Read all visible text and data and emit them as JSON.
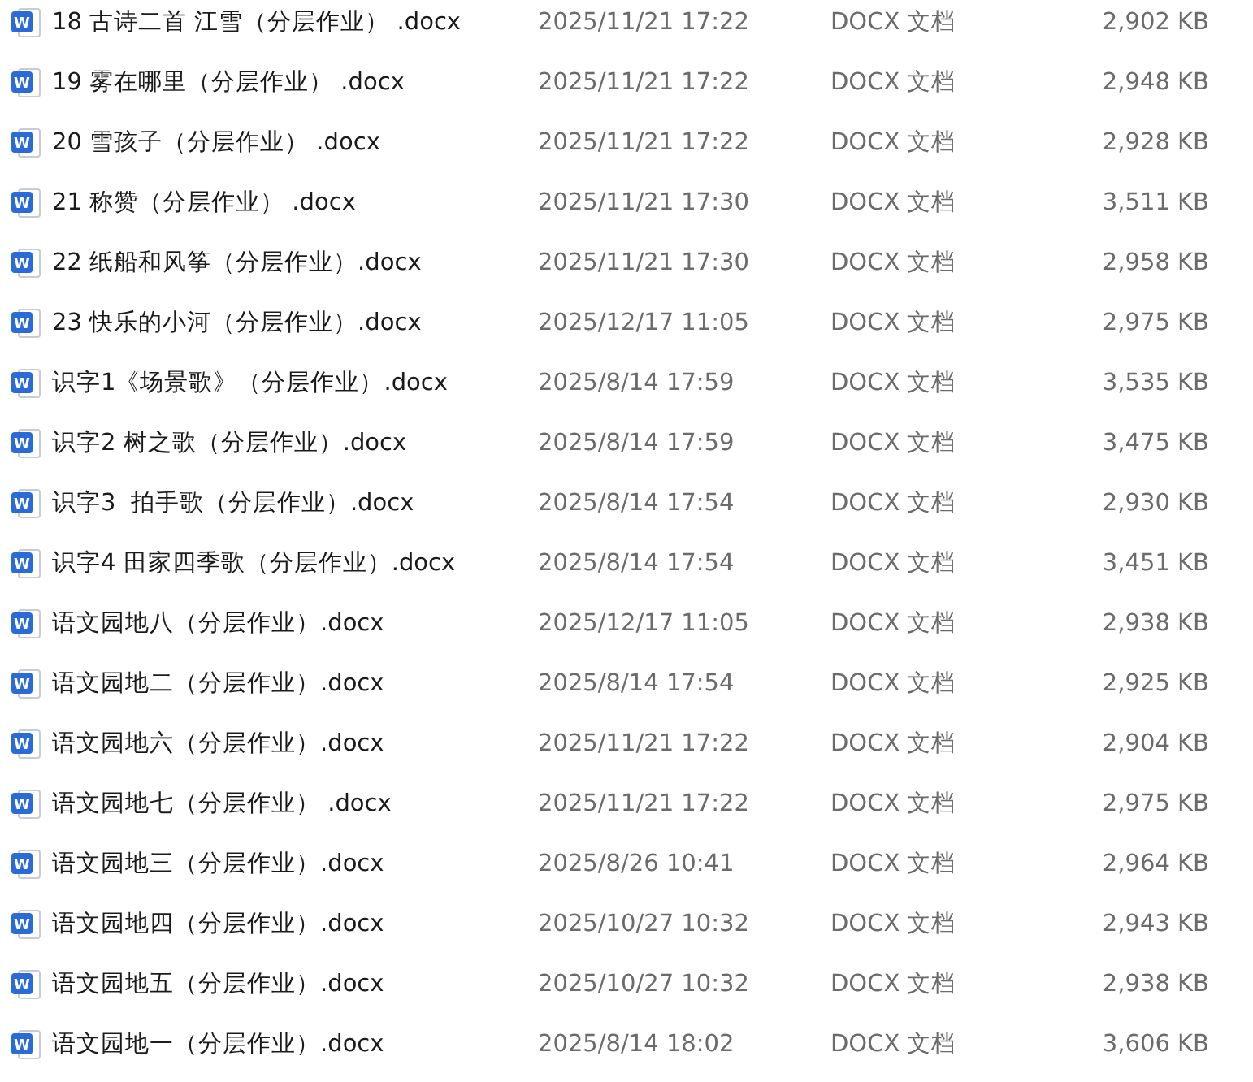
{
  "files": [
    {
      "icon_letter": "W",
      "name": "18 古诗二首 江雪（分层作业） .docx",
      "modified": "2025/11/21 17:22",
      "type": "DOCX 文档",
      "size": "2,902 KB"
    },
    {
      "icon_letter": "W",
      "name": "19 雾在哪里（分层作业） .docx",
      "modified": "2025/11/21 17:22",
      "type": "DOCX 文档",
      "size": "2,948 KB"
    },
    {
      "icon_letter": "W",
      "name": "20 雪孩子（分层作业） .docx",
      "modified": "2025/11/21 17:22",
      "type": "DOCX 文档",
      "size": "2,928 KB"
    },
    {
      "icon_letter": "W",
      "name": "21 称赞（分层作业） .docx",
      "modified": "2025/11/21 17:30",
      "type": "DOCX 文档",
      "size": "3,511 KB"
    },
    {
      "icon_letter": "W",
      "name": "22 纸船和风筝（分层作业）.docx",
      "modified": "2025/11/21 17:30",
      "type": "DOCX 文档",
      "size": "2,958 KB"
    },
    {
      "icon_letter": "W",
      "name": "23 快乐的小河（分层作业）.docx",
      "modified": "2025/12/17 11:05",
      "type": "DOCX 文档",
      "size": "2,975 KB"
    },
    {
      "icon_letter": "W",
      "name": "识字1《场景歌》（分层作业）.docx",
      "modified": "2025/8/14 17:59",
      "type": "DOCX 文档",
      "size": "3,535 KB"
    },
    {
      "icon_letter": "W",
      "name": "识字2 树之歌（分层作业）.docx",
      "modified": "2025/8/14 17:59",
      "type": "DOCX 文档",
      "size": "3,475 KB"
    },
    {
      "icon_letter": "W",
      "name": "识字3  拍手歌（分层作业）.docx",
      "modified": "2025/8/14 17:54",
      "type": "DOCX 文档",
      "size": "2,930 KB"
    },
    {
      "icon_letter": "W",
      "name": "识字4 田家四季歌（分层作业）.docx",
      "modified": "2025/8/14 17:54",
      "type": "DOCX 文档",
      "size": "3,451 KB"
    },
    {
      "icon_letter": "W",
      "name": "语文园地八（分层作业）.docx",
      "modified": "2025/12/17 11:05",
      "type": "DOCX 文档",
      "size": "2,938 KB"
    },
    {
      "icon_letter": "W",
      "name": "语文园地二（分层作业）.docx",
      "modified": "2025/8/14 17:54",
      "type": "DOCX 文档",
      "size": "2,925 KB"
    },
    {
      "icon_letter": "W",
      "name": "语文园地六（分层作业）.docx",
      "modified": "2025/11/21 17:22",
      "type": "DOCX 文档",
      "size": "2,904 KB"
    },
    {
      "icon_letter": "W",
      "name": "语文园地七（分层作业） .docx",
      "modified": "2025/11/21 17:22",
      "type": "DOCX 文档",
      "size": "2,975 KB"
    },
    {
      "icon_letter": "W",
      "name": "语文园地三（分层作业）.docx",
      "modified": "2025/8/26 10:41",
      "type": "DOCX 文档",
      "size": "2,964 KB"
    },
    {
      "icon_letter": "W",
      "name": "语文园地四（分层作业）.docx",
      "modified": "2025/10/27 10:32",
      "type": "DOCX 文档",
      "size": "2,943 KB"
    },
    {
      "icon_letter": "W",
      "name": "语文园地五（分层作业）.docx",
      "modified": "2025/10/27 10:32",
      "type": "DOCX 文档",
      "size": "2,938 KB"
    },
    {
      "icon_letter": "W",
      "name": "语文园地一（分层作业）.docx",
      "modified": "2025/8/14 18:02",
      "type": "DOCX 文档",
      "size": "3,606 KB"
    }
  ]
}
